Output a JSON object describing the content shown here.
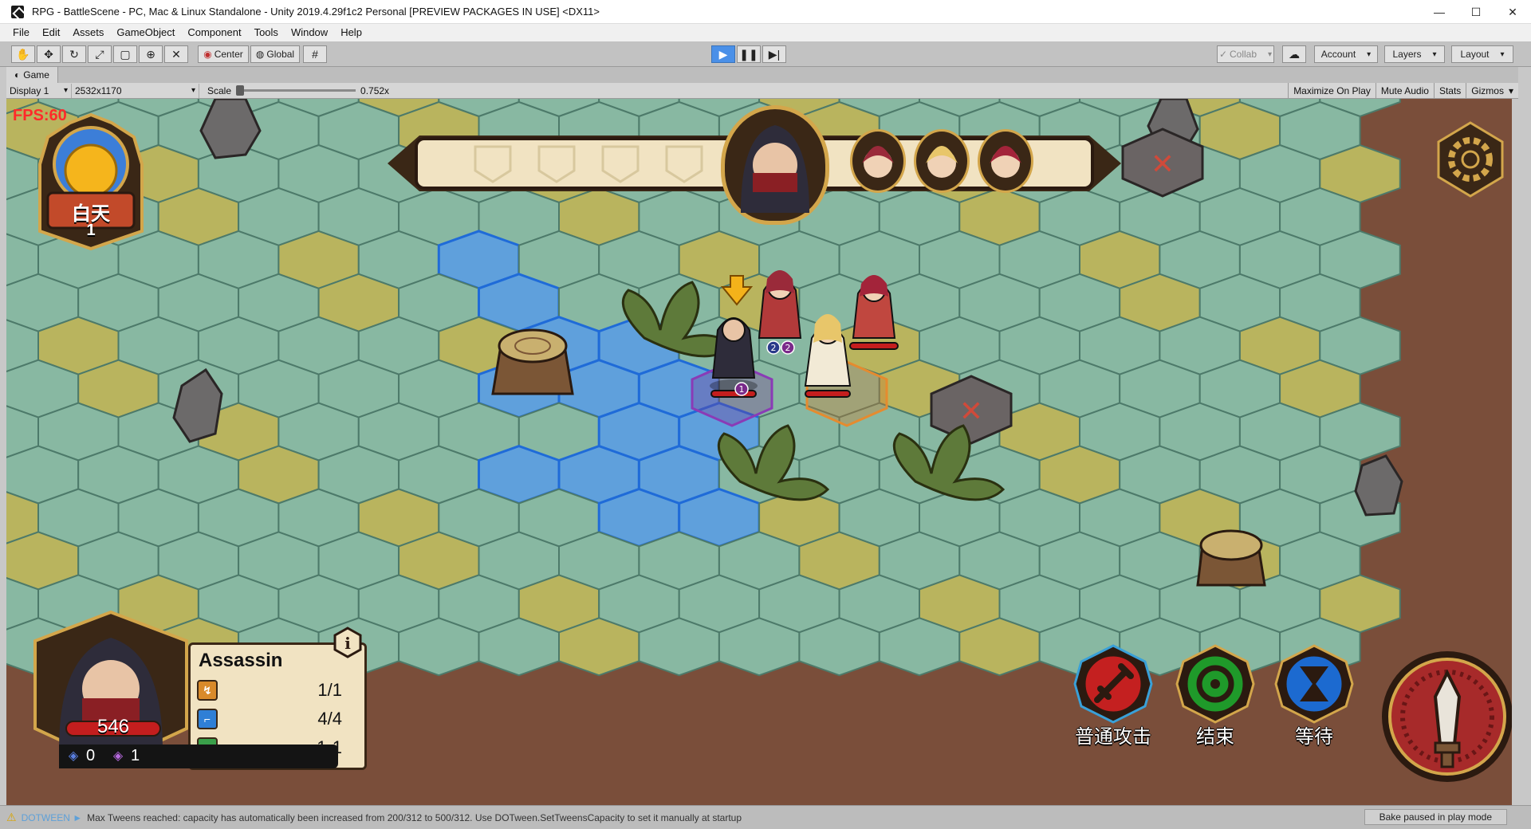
{
  "window": {
    "title": "RPG - BattleScene - PC, Mac & Linux Standalone - Unity 2019.4.29f1c2 Personal [PREVIEW PACKAGES IN USE] <DX11>",
    "minimize": "—",
    "maximize": "☐",
    "close": "✕"
  },
  "menu": {
    "items": [
      "File",
      "Edit",
      "Assets",
      "GameObject",
      "Component",
      "Tools",
      "Window",
      "Help"
    ]
  },
  "toolbar": {
    "pivot_label": "Center",
    "space_label": "Global",
    "collab_label": "Collab",
    "account_label": "Account",
    "layers_label": "Layers",
    "layout_label": "Layout",
    "tool_icons": [
      "hand-icon",
      "move-icon",
      "rotate-icon",
      "scale-icon",
      "rect-icon",
      "transform-icon",
      "custom-tool-icon"
    ]
  },
  "game_view": {
    "tab_label": "Game",
    "display": "Display 1",
    "resolution": "2532x1170",
    "scale_label": "Scale",
    "scale_value": "0.752x",
    "maximize_on_play": "Maximize On Play",
    "mute_audio": "Mute Audio",
    "stats": "Stats",
    "gizmos": "Gizmos"
  },
  "hud": {
    "fps": "FPS:60",
    "day_label": "白天",
    "day_number": "1",
    "unit": {
      "name": "Assassin",
      "stats": [
        {
          "icon": "action-icon",
          "value": "1/1",
          "color": "#d98a2a"
        },
        {
          "icon": "boot-icon",
          "value": "4/4",
          "color": "#2f7fd6"
        },
        {
          "icon": "target-icon",
          "value": "1-1",
          "color": "#3aa04a"
        }
      ],
      "hp": "546",
      "resources": [
        {
          "icon": "blue-gem-icon",
          "value": "0"
        },
        {
          "icon": "purple-gem-icon",
          "value": "1"
        }
      ],
      "info_glyph": "i"
    },
    "actions": [
      {
        "label": "普通攻击",
        "color": "#c42020",
        "icon": "sword-icon"
      },
      {
        "label": "结束",
        "color": "#1f9a2a",
        "icon": "end-icon"
      },
      {
        "label": "等待",
        "color": "#1c6ad0",
        "icon": "hourglass-icon"
      }
    ],
    "unit_badges": [
      "1",
      "2",
      "2"
    ]
  },
  "status": {
    "tag": "DOTWEEN ►",
    "message": "Max Tweens reached: capacity has automatically been increased from 200/312 to 500/312. Use DOTween.SetTweensCapacity to set it manually at startup",
    "bake": "Bake paused in play mode"
  },
  "colors": {
    "board_bg": "#7a4e3a",
    "grass_teal": "#88b8a2",
    "grass_yellow": "#b9b45e",
    "water_blue": "#5fa0dc",
    "ui_dark": "#2b1a10",
    "ui_cream": "#f1e3c2"
  }
}
